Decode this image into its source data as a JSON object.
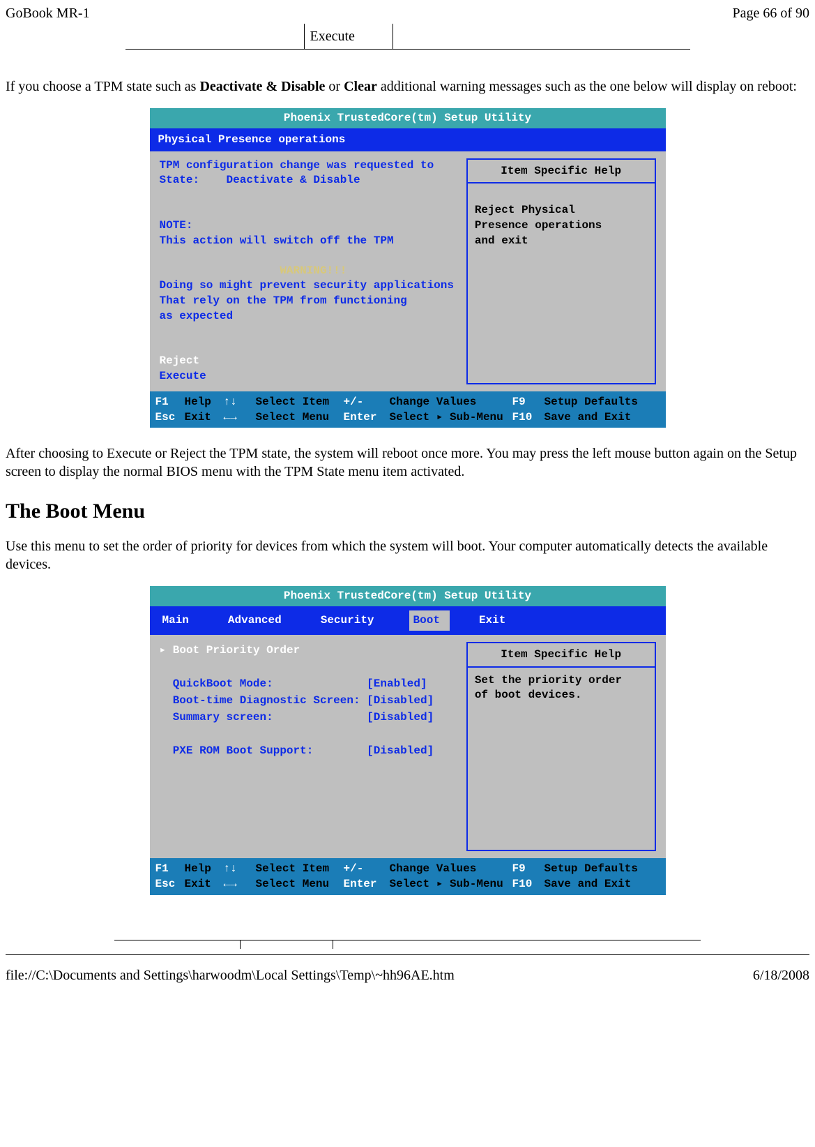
{
  "header": {
    "left": "GoBook MR-1",
    "right": "Page 66 of 90"
  },
  "executeTable": {
    "middle": "Execute"
  },
  "intro": {
    "prefix": "If you choose a TPM state such as ",
    "bold1": "Deactivate & Disable",
    "mid": " or ",
    "bold2": "Clear",
    "suffix": " additional warning messages such as the one below will display on reboot:"
  },
  "bios1": {
    "title": "Phoenix TrustedCore(tm) Setup Utility",
    "tab": "Physical Presence operations",
    "lines": {
      "l1": "TPM configuration change was requested to",
      "l2": "State:    Deactivate & Disable",
      "l3": "",
      "l4": "",
      "l5": "NOTE:",
      "l6": "This action will switch off the TPM",
      "l7": "",
      "l8_pad": "                  ",
      "l8": "WARNING!!!",
      "l9": "Doing so might prevent security applications",
      "l10": "That rely on the TPM from functioning",
      "l11": "as expected",
      "l12": "",
      "l13": "",
      "reject": "Reject",
      "execute": "Execute"
    },
    "helpHeader": "Item Specific Help",
    "helpBody1": "Reject Physical",
    "helpBody2": "Presence operations",
    "helpBody3": "and exit",
    "footer": {
      "f1": "F1",
      "help": "Help",
      "upDown": "↑↓",
      "selectItem": "Select Item",
      "plusMinus": "+/-",
      "changeValues": "Change Values",
      "f9": "F9",
      "setupDefaults": "Setup Defaults",
      "esc": "Esc",
      "exit": "Exit",
      "leftRight": "←→",
      "selectMenu": "Select Menu",
      "enter": "Enter",
      "selectSub": "Select ▸ Sub-Menu",
      "f10": "F10",
      "saveExit": "Save and Exit"
    }
  },
  "afterBios1": "After choosing to  Execute or Reject the TPM state, the system will reboot once more.   You may press the left mouse button again on the Setup screen to display the normal BIOS menu with the TPM State menu item activated.",
  "bootMenuHeading": "The Boot Menu",
  "bootMenuDesc": "Use this menu to set the order of priority for devices from which the system will boot. Your computer automatically detects the available devices.",
  "bios2": {
    "title": "Phoenix TrustedCore(tm) Setup Utility",
    "tabs": {
      "main": "Main",
      "advanced": "Advanced",
      "security": "Security",
      "boot": "Boot",
      "exit": "Exit"
    },
    "lines": {
      "bootPriority": "▸ Boot Priority Order",
      "quickBoot": "QuickBoot Mode:",
      "quickBootVal": "[Enabled]",
      "diag": "Boot-time Diagnostic Screen:",
      "diagVal": "[Disabled]",
      "summary": "Summary screen:",
      "summaryVal": "[Disabled]",
      "pxe": "PXE ROM Boot Support:",
      "pxeVal": "[Disabled]"
    },
    "helpHeader": "Item Specific Help",
    "helpBody1": "Set the priority order",
    "helpBody2": "of boot devices."
  },
  "footer": {
    "path": "file://C:\\Documents and Settings\\harwoodm\\Local Settings\\Temp\\~hh96AE.htm",
    "date": "6/18/2008"
  }
}
